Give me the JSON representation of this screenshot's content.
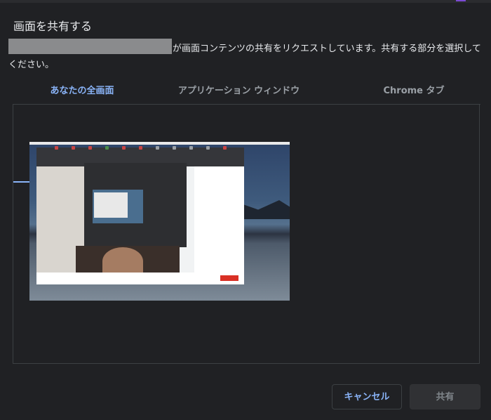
{
  "dialog": {
    "title": "画面を共有する",
    "message_line1": "が画面コンテンツの共有をリクエストしています。共有する部分を選択して",
    "message_line2": "ください。"
  },
  "tabs": [
    {
      "label": "あなたの全画面",
      "active": true
    },
    {
      "label": "アプリケーション ウィンドウ",
      "active": false
    },
    {
      "label": "Chrome タブ",
      "active": false
    }
  ],
  "buttons": {
    "cancel_label": "キャンセル",
    "share_label": "共有",
    "share_enabled": false
  },
  "colors": {
    "background": "#202124",
    "accent": "#8ab4f8",
    "text": "#e8eaed",
    "muted_text": "#9aa0a6",
    "border": "#3c4043"
  }
}
